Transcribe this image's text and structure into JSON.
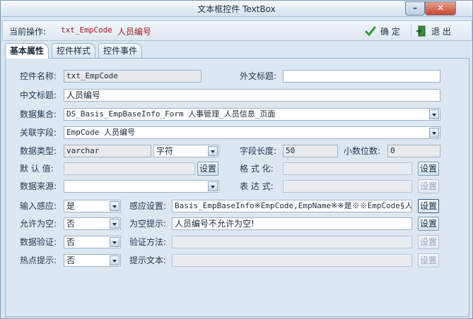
{
  "window": {
    "title": "文本框控件 TextBox"
  },
  "operation": {
    "label": "当前操作:",
    "control_name": "txt_EmpCode",
    "control_cn": "人员编号"
  },
  "toolbar": {
    "confirm_label": "确 定",
    "exit_label": "退 出"
  },
  "tabs": [
    "基本属性",
    "控件样式",
    "控件事件"
  ],
  "form": {
    "name_label": "控件名称:",
    "name_value": "txt_EmpCode",
    "foreign_label": "外文标题:",
    "foreign_value": "",
    "cn_label": "中文标题:",
    "cn_value": "人员编号",
    "dataset_label": "数据集合:",
    "dataset_value": "DS_Basis_EmpBaseInfo_Form  人事管理_人员信息_页面",
    "field_label": "关联字段:",
    "field_value": "EmpCode   人员编号",
    "type_label": "数据类型:",
    "type_value": "varchar",
    "type_kind": "字符",
    "length_label": "字段长度:",
    "length_value": "50",
    "decimal_label": "小数位数:",
    "decimal_value": "0",
    "default_label": "默 认 值:",
    "default_value": "",
    "format_label": "格 式 化:",
    "format_value": "",
    "source_label": "数据来源:",
    "source_value": "",
    "expr_label": "表 达 式:",
    "expr_value": "",
    "input_sense_label": "输入感应:",
    "input_sense_value": "是",
    "sense_setting_label": "感应设置:",
    "sense_setting_value": "Basis_EmpBaseInfo※EmpCode,EmpName※※是※※EmpCode§人员",
    "allow_empty_label": "允许为空:",
    "allow_empty_value": "否",
    "empty_tip_label": "为空提示:",
    "empty_tip_value": "人员编号不允许为空!",
    "validate_label": "数据验证:",
    "validate_value": "否",
    "validate_method_label": "验证方法:",
    "validate_method_value": "",
    "hotspot_label": "热点提示:",
    "hotspot_value": "否",
    "hint_text_label": "提示文本:",
    "hint_text_value": "",
    "setting_button": "设置"
  },
  "colors": {
    "accent": "#9b1c1c",
    "panel": "#dde7f1",
    "border": "#9eb6cf"
  }
}
